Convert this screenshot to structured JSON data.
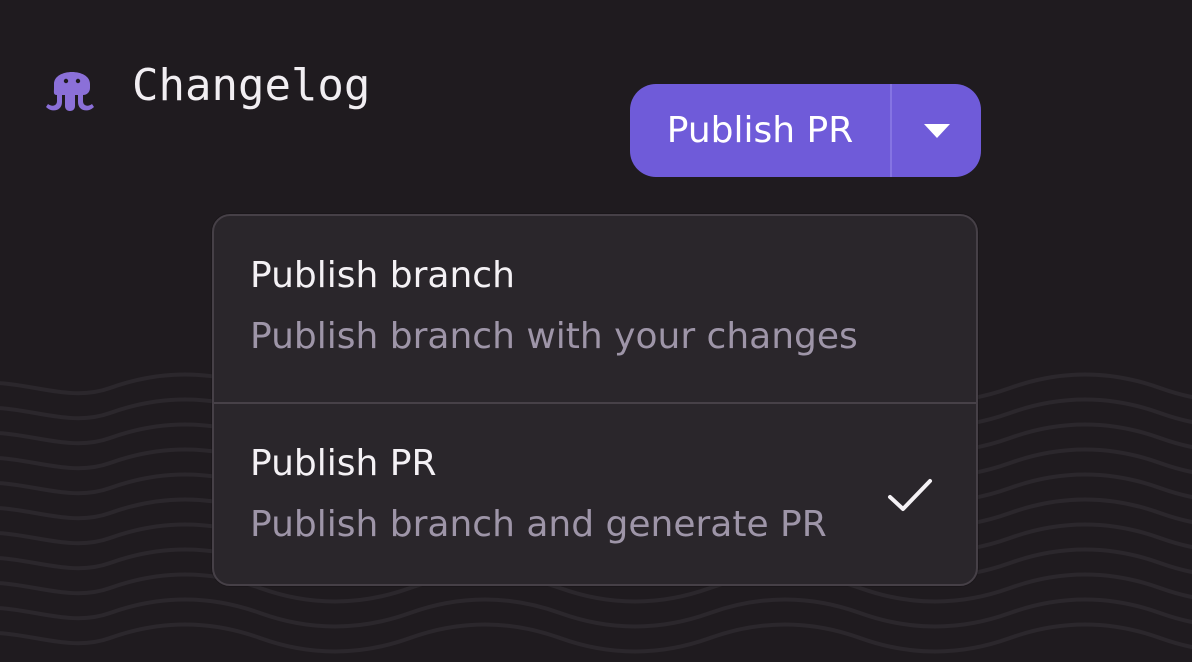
{
  "app": {
    "title": "Changelog"
  },
  "header": {
    "primary_button_label": "Publish PR"
  },
  "menu": {
    "items": [
      {
        "title": "Publish branch",
        "description": "Publish branch with your changes",
        "selected": false
      },
      {
        "title": "Publish PR",
        "description": "Publish branch and generate PR",
        "selected": true
      }
    ]
  },
  "colors": {
    "background": "#1f1b1f",
    "wave_lines": "#2b272c",
    "logo": "#8b70d8",
    "accent": "#6f5bd9",
    "menu_background": "#2a262b",
    "menu_border": "#464047",
    "secondary_text": "#9e95a8",
    "text": "#f4f1f5"
  },
  "icons": {
    "logo": "octopus-icon",
    "dropdown_toggle": "caret-down-icon",
    "selected_indicator": "checkmark-icon"
  }
}
